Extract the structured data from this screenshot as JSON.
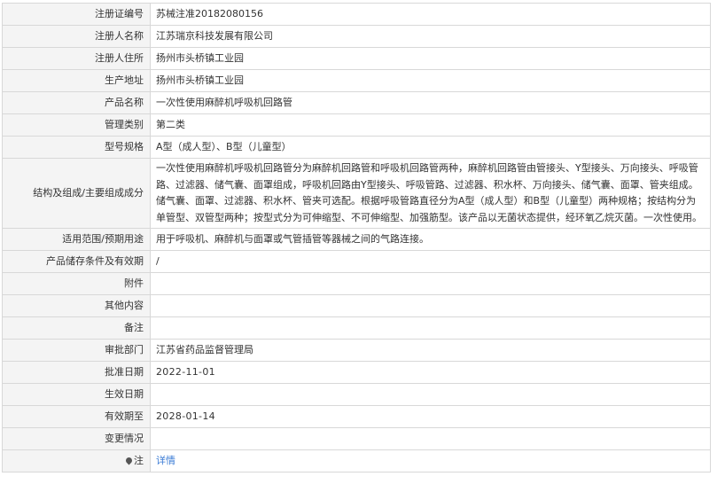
{
  "rows": [
    {
      "label": "注册证编号",
      "value": "苏械注准20182080156"
    },
    {
      "label": "注册人名称",
      "value": "江苏瑞京科技发展有限公司"
    },
    {
      "label": "注册人住所",
      "value": "扬州市头桥镇工业园"
    },
    {
      "label": "生产地址",
      "value": "扬州市头桥镇工业园"
    },
    {
      "label": "产品名称",
      "value": "一次性使用麻醉机呼吸机回路管"
    },
    {
      "label": "管理类别",
      "value": "第二类"
    },
    {
      "label": "型号规格",
      "value": "A型（成人型）、B型（儿童型）"
    },
    {
      "label": "结构及组成/主要组成成分",
      "value": "一次性使用麻醉机呼吸机回路管分为麻醉机回路管和呼吸机回路管两种，麻醉机回路管由管接头、Y型接头、万向接头、呼吸管路、过滤器、储气囊、面罩组成，呼吸机回路由Y型接头、呼吸管路、过滤器、积水杯、万向接头、储气囊、面罩、管夹组成。储气囊、面罩、过滤器、积水杯、管夹可选配。根据呼吸管路直径分为A型（成人型）和B型（儿童型）两种规格；按结构分为单管型、双管型两种；按型式分为可伸缩型、不可伸缩型、加强筋型。该产品以无菌状态提供，经环氧乙烷灭菌。一次性使用。"
    },
    {
      "label": "适用范围/预期用途",
      "value": "用于呼吸机、麻醉机与面罩或气管插管等器械之间的气路连接。"
    },
    {
      "label": "产品储存条件及有效期",
      "value": "/"
    },
    {
      "label": "附件",
      "value": ""
    },
    {
      "label": "其他内容",
      "value": ""
    },
    {
      "label": "备注",
      "value": ""
    },
    {
      "label": "审批部门",
      "value": "江苏省药品监督管理局"
    },
    {
      "label": "批准日期",
      "value": "2022-11-01"
    },
    {
      "label": "生效日期",
      "value": ""
    },
    {
      "label": "有效期至",
      "value": "2028-01-14"
    },
    {
      "label": "变更情况",
      "value": ""
    }
  ],
  "note": {
    "label": "注",
    "icon": "pin-icon",
    "link_text": "详情",
    "link_color": "#3a7bd5"
  },
  "colors": {
    "label_bg": "#f4f4f4",
    "border": "#d8d8d8",
    "text": "#333333"
  }
}
